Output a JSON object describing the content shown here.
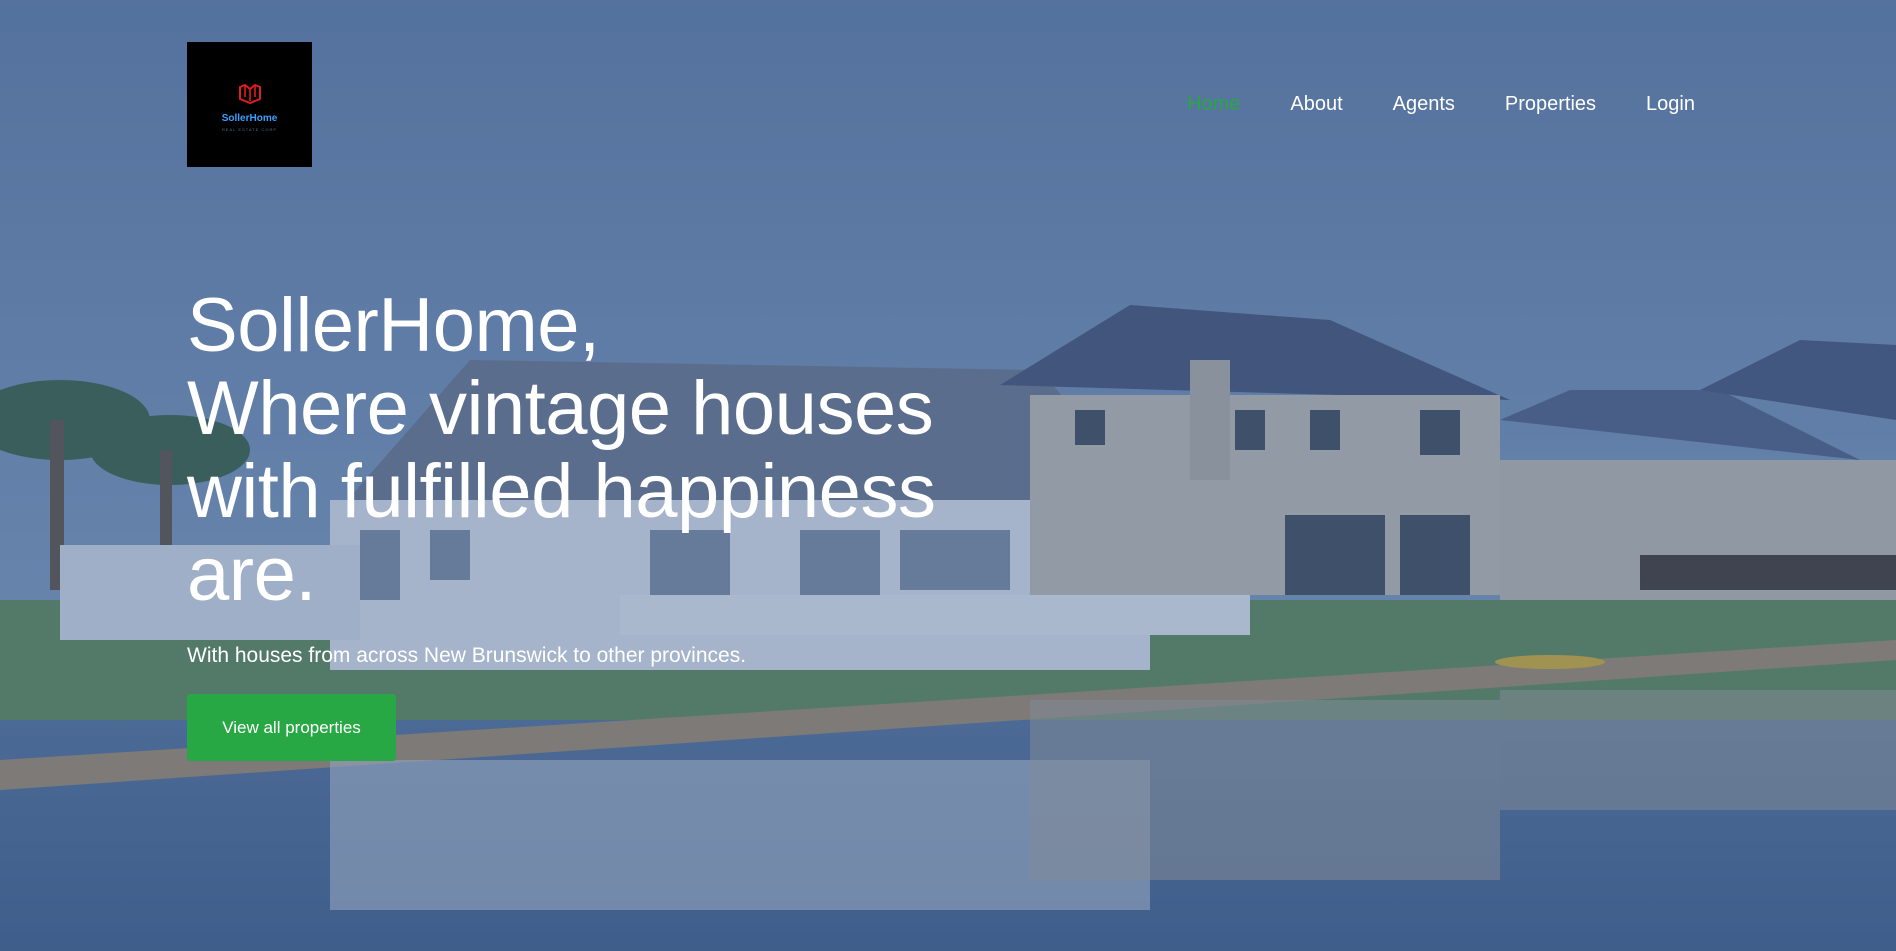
{
  "brand": {
    "name": "SollerHome",
    "tagline": "REAL ESTATE CORP",
    "colors": {
      "mark": "#e11d1d",
      "name": "#3aa0ff",
      "accent": "#28a745"
    }
  },
  "nav": {
    "items": [
      {
        "label": "Home",
        "active": true
      },
      {
        "label": "About",
        "active": false
      },
      {
        "label": "Agents",
        "active": false
      },
      {
        "label": "Properties",
        "active": false
      },
      {
        "label": "Login",
        "active": false
      }
    ]
  },
  "hero": {
    "title_line1": "SollerHome,",
    "title_line2": "Where vintage houses",
    "title_line3": "with fulfilled happiness",
    "title_line4": "are.",
    "subtitle": "With houses from across New Brunswick to other provinces.",
    "cta_label": "View all properties"
  }
}
